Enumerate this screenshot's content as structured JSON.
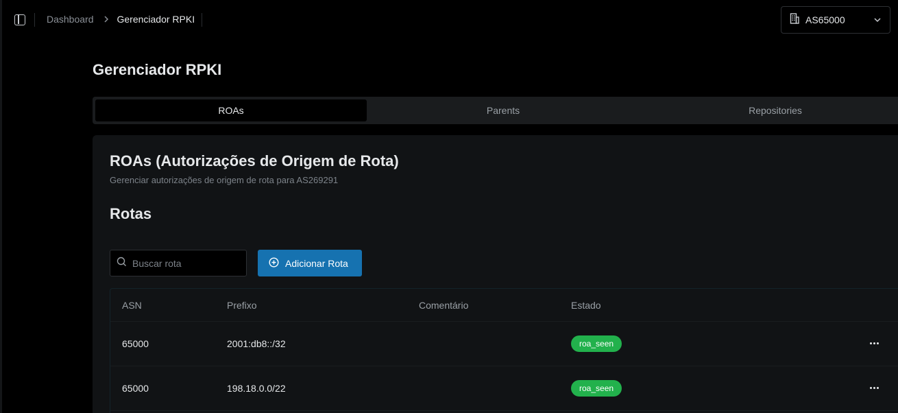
{
  "header": {
    "breadcrumb": {
      "parent": "Dashboard",
      "current": "Gerenciador RPKI"
    },
    "as_selector": {
      "value": "AS65000",
      "icon": "building-icon"
    }
  },
  "page": {
    "title": "Gerenciador RPKI"
  },
  "tabs": [
    {
      "label": "ROAs",
      "active": true
    },
    {
      "label": "Parents",
      "active": false
    },
    {
      "label": "Repositories",
      "active": false
    }
  ],
  "card": {
    "title": "ROAs (Autorizações de Origem de Rota)",
    "subtitle": "Gerenciar autorizações de origem de rota para AS269291",
    "section_title": "Rotas"
  },
  "search": {
    "placeholder": "Buscar rota",
    "value": ""
  },
  "add_button": {
    "label": "Adicionar Rota"
  },
  "table": {
    "columns": [
      "ASN",
      "Prefixo",
      "Comentário",
      "Estado"
    ],
    "rows": [
      {
        "asn": "65000",
        "prefix": "2001:db8::/32",
        "comment": "",
        "state": "roa_seen"
      },
      {
        "asn": "65000",
        "prefix": "198.18.0.0/22",
        "comment": "",
        "state": "roa_seen"
      }
    ]
  },
  "colors": {
    "accent": "#1672b0",
    "status_seen": "#22b14c",
    "background": "#000000",
    "card": "#111315"
  }
}
